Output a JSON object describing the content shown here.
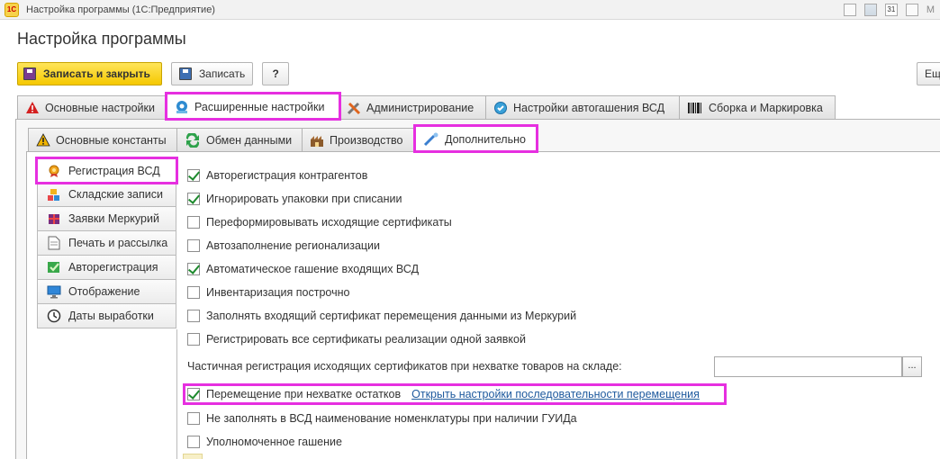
{
  "window": {
    "title": "Настройка программы  (1С:Предприятие)",
    "logo": "1С",
    "right_letter": "М",
    "calendar_day": "31"
  },
  "page": {
    "title": "Настройка программы"
  },
  "toolbar": {
    "save_close": "Записать и закрыть",
    "save": "Записать",
    "help": "?",
    "more": "Еще"
  },
  "main_tabs": [
    {
      "label": "Основные настройки",
      "icon": "warning-icon"
    },
    {
      "label": "Расширенные настройки",
      "icon": "settings-gear-icon"
    },
    {
      "label": "Администрирование",
      "icon": "tools-icon"
    },
    {
      "label": "Настройки автогашения ВСД",
      "icon": "auto-settings-icon"
    },
    {
      "label": "Сборка и Маркировка",
      "icon": "barcode-icon"
    }
  ],
  "sub_tabs": [
    {
      "label": "Основные константы",
      "icon": "warning-icon"
    },
    {
      "label": "Обмен данными",
      "icon": "exchange-icon"
    },
    {
      "label": "Производство",
      "icon": "production-icon"
    },
    {
      "label": "Дополнительно",
      "icon": "wand-icon"
    }
  ],
  "sidebar": [
    {
      "label": "Регистрация ВСД",
      "icon": "certificate-icon"
    },
    {
      "label": "Складские записи",
      "icon": "warehouse-icon"
    },
    {
      "label": "Заявки Меркурий",
      "icon": "package-icon"
    },
    {
      "label": "Печать и рассылка",
      "icon": "printer-icon"
    },
    {
      "label": "Авторегистрация",
      "icon": "check-icon"
    },
    {
      "label": "Отображение",
      "icon": "monitor-icon"
    },
    {
      "label": "Даты выработки",
      "icon": "clock-icon"
    }
  ],
  "options": [
    {
      "label": "Авторегистрация контрагентов",
      "checked": true
    },
    {
      "label": "Игнорировать упаковки при списании",
      "checked": true
    },
    {
      "label": "Переформировывать исходящие сертификаты",
      "checked": false
    },
    {
      "label": "Автозаполнение регионализации",
      "checked": false
    },
    {
      "label": "Автоматическое гашение входящих ВСД",
      "checked": true
    },
    {
      "label": "Инвентаризация построчно",
      "checked": false
    },
    {
      "label": "Заполнять входящий сертификат перемещения данными из Меркурий",
      "checked": false
    },
    {
      "label": "Регистрировать все сертификаты реализации одной заявкой",
      "checked": false
    }
  ],
  "partial_field": {
    "label": "Частичная регистрация исходящих сертификатов при нехватке товаров на складе:",
    "value": "",
    "button": "..."
  },
  "options2": [
    {
      "label": "Перемещение при нехватке остатков",
      "checked": true,
      "link": "Открыть настройки последовательности перемещения"
    },
    {
      "label": "Не заполнять в ВСД наименование номенклатуры при наличии ГУИДа",
      "checked": false
    },
    {
      "label": "Уполномоченное гашение",
      "checked": false
    }
  ]
}
